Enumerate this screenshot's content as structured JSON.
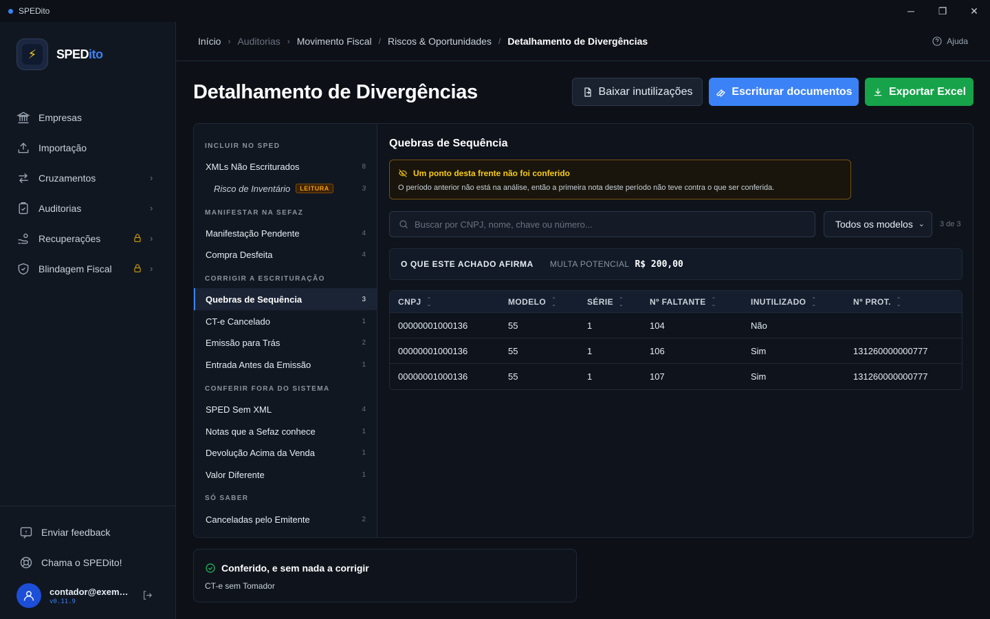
{
  "window": {
    "title": "SPEDito",
    "controls": {
      "minimize": "─",
      "maximize": "❐",
      "close": "✕"
    }
  },
  "brand": {
    "name_a": "SPED",
    "name_b": "ito"
  },
  "sidebar": {
    "items": [
      {
        "label": "Empresas"
      },
      {
        "label": "Importação"
      },
      {
        "label": "Cruzamentos"
      },
      {
        "label": "Auditorias"
      },
      {
        "label": "Recuperações"
      },
      {
        "label": "Blindagem Fiscal"
      }
    ],
    "chevron": "›",
    "feedback": "Enviar feedback",
    "support": "Chama o SPEDito!",
    "user": {
      "email": "contador@exemplo.com",
      "version": "v0.11.9"
    }
  },
  "breadcrumb": {
    "items": [
      "Início",
      "Auditorias",
      "Movimento Fiscal",
      "Riscos & Oportunidades",
      "Detalhamento de Divergências"
    ],
    "separators": [
      "›",
      "›",
      "/",
      "/"
    ]
  },
  "help": "Ajuda",
  "page_title": "Detalhamento de Divergências",
  "actions": {
    "download": "Baixar inutilizações",
    "book": "Escriturar documentos",
    "export": "Exportar Excel"
  },
  "categories": {
    "groups": [
      "INCLUIR NO SPED",
      "MANIFESTAR NA SEFAZ",
      "CORRIGIR A ESCRITURAÇÃO",
      "CONFERIR FORA DO SISTEMA",
      "SÓ SABER"
    ],
    "items": [
      {
        "label": "XMLs Não Escriturados",
        "count": "8"
      },
      {
        "label": "Risco de Inventário",
        "count": "3",
        "badge": "LEITURA"
      },
      {
        "label": "Manifestação Pendente",
        "count": "4"
      },
      {
        "label": "Compra Desfeita",
        "count": "4"
      },
      {
        "label": "Quebras de Sequência",
        "count": "3"
      },
      {
        "label": "CT-e Cancelado",
        "count": "1"
      },
      {
        "label": "Emissão para Trás",
        "count": "2"
      },
      {
        "label": "Entrada Antes da Emissão",
        "count": "1"
      },
      {
        "label": "SPED Sem XML",
        "count": "4"
      },
      {
        "label": "Notas que a Sefaz conhece",
        "count": "1"
      },
      {
        "label": "Devolução Acima da Venda",
        "count": "1"
      },
      {
        "label": "Valor Diferente",
        "count": "1"
      },
      {
        "label": "Canceladas pelo Emitente",
        "count": "2"
      }
    ],
    "active": "Quebras de Sequência"
  },
  "section": {
    "title": "Quebras de Sequência",
    "alert": {
      "title": "Um ponto desta frente não foi conferido",
      "text": "O período anterior não está na análise, então a primeira nota deste período não teve contra o que ser conferida."
    },
    "search_placeholder": "Buscar por CNPJ, nome, chave ou número...",
    "model_filter": "Todos os modelos",
    "result_count": "3 de 3",
    "finding": {
      "label": "O QUE ESTE ACHADO AFIRMA",
      "fine_label": "MULTA POTENCIAL",
      "fine_value": "R$ 200,00"
    }
  },
  "table": {
    "columns": [
      "CNPJ",
      "MODELO",
      "SÉRIE",
      "Nº FALTANTE",
      "INUTILIZADO",
      "Nº PROT."
    ],
    "rows": [
      [
        "00000001000136",
        "55",
        "1",
        "104",
        "Não",
        ""
      ],
      [
        "00000001000136",
        "55",
        "1",
        "106",
        "Sim",
        "131260000000777"
      ],
      [
        "00000001000136",
        "55",
        "1",
        "107",
        "Sim",
        "131260000000777"
      ]
    ]
  },
  "ok_card": {
    "title": "Conferido, e sem nada a corrigir",
    "item": "CT-e sem Tomador"
  },
  "colors": {
    "accent": "#3b82f6",
    "success": "#16a34a",
    "warning": "#facc15",
    "bg": "#0d1117"
  }
}
